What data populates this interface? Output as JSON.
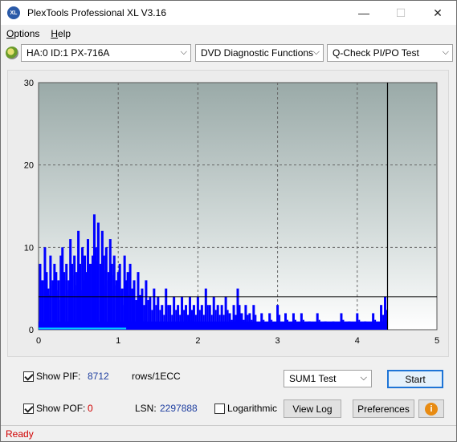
{
  "window": {
    "title": "PlexTools Professional XL V3.16",
    "icon_text": "XL"
  },
  "window_controls": {
    "minimize": "—",
    "maximize": "☐",
    "close": "✕"
  },
  "menu": [
    "Options",
    "Help"
  ],
  "toolbar": {
    "drive": "HA:0 ID:1  PX-716A",
    "function": "DVD Diagnostic Functions",
    "test": "Q-Check PI/PO Test"
  },
  "chart_data": {
    "type": "bar",
    "title": "",
    "xlabel": "",
    "ylabel": "",
    "xlim": [
      0,
      5
    ],
    "ylim": [
      0,
      30
    ],
    "x_ticks": [
      "0",
      "1",
      "2",
      "3",
      "4",
      "5"
    ],
    "y_ticks": [
      "0",
      "10",
      "20",
      "30"
    ],
    "grid": true,
    "scan_end_x": 4.38,
    "threshold_y": 4,
    "series": [
      {
        "color": "#0000ff",
        "x": [
          0.02,
          0.05,
          0.08,
          0.1,
          0.12,
          0.15,
          0.18,
          0.2,
          0.22,
          0.25,
          0.28,
          0.3,
          0.32,
          0.35,
          0.38,
          0.4,
          0.42,
          0.45,
          0.48,
          0.5,
          0.52,
          0.55,
          0.58,
          0.6,
          0.62,
          0.65,
          0.68,
          0.7,
          0.72,
          0.75,
          0.78,
          0.8,
          0.82,
          0.85,
          0.88,
          0.9,
          0.92,
          0.95,
          0.98,
          1.0,
          1.02,
          1.05,
          1.08,
          1.1,
          1.12,
          1.15,
          1.18,
          1.2,
          1.25,
          1.3,
          1.35,
          1.4,
          1.45,
          1.5,
          1.55,
          1.6,
          1.65,
          1.7,
          1.75,
          1.8,
          1.85,
          1.9,
          1.95,
          2.0,
          2.05,
          2.1,
          2.15,
          2.2,
          2.25,
          2.3,
          2.35,
          2.4,
          2.45,
          2.5,
          2.55,
          2.6,
          2.65,
          2.7,
          2.8,
          2.9,
          3.0,
          3.1,
          3.2,
          3.3,
          3.4,
          3.5,
          3.6,
          3.7,
          3.8,
          3.9,
          4.0,
          4.1,
          4.2,
          4.3,
          4.35
        ],
        "values": [
          8,
          6,
          10,
          7,
          5,
          9,
          6,
          8,
          7,
          6,
          9,
          10,
          7,
          8,
          6,
          11,
          8,
          9,
          7,
          12,
          8,
          10,
          9,
          7,
          11,
          8,
          9,
          14,
          10,
          13,
          8,
          12,
          9,
          10,
          7,
          11,
          8,
          9,
          6,
          7,
          8,
          5,
          9,
          6,
          7,
          8,
          5,
          6,
          7,
          5,
          6,
          4,
          5,
          4,
          3,
          5,
          3,
          4,
          3,
          4,
          3,
          4,
          3,
          4,
          3,
          5,
          3,
          4,
          3,
          3,
          4,
          2,
          3,
          5,
          2,
          3,
          2,
          3,
          2,
          2,
          3,
          2,
          2,
          2,
          1,
          2,
          1,
          1,
          2,
          1,
          2,
          1,
          2,
          3,
          4
        ]
      }
    ]
  },
  "controls": {
    "show_pif_label": "Show PIF:",
    "pif_value": "8712",
    "pif_unit": "rows/1ECC",
    "show_pof_label": "Show POF:",
    "pof_value": "0",
    "lsn_label": "LSN:",
    "lsn_value": "2297888",
    "logarithmic_label": "Logarithmic",
    "test_select": "SUM1 Test",
    "start_label": "Start",
    "view_log_label": "View Log",
    "preferences_label": "Preferences",
    "info_glyph": "i"
  },
  "status": {
    "text": "Ready"
  }
}
